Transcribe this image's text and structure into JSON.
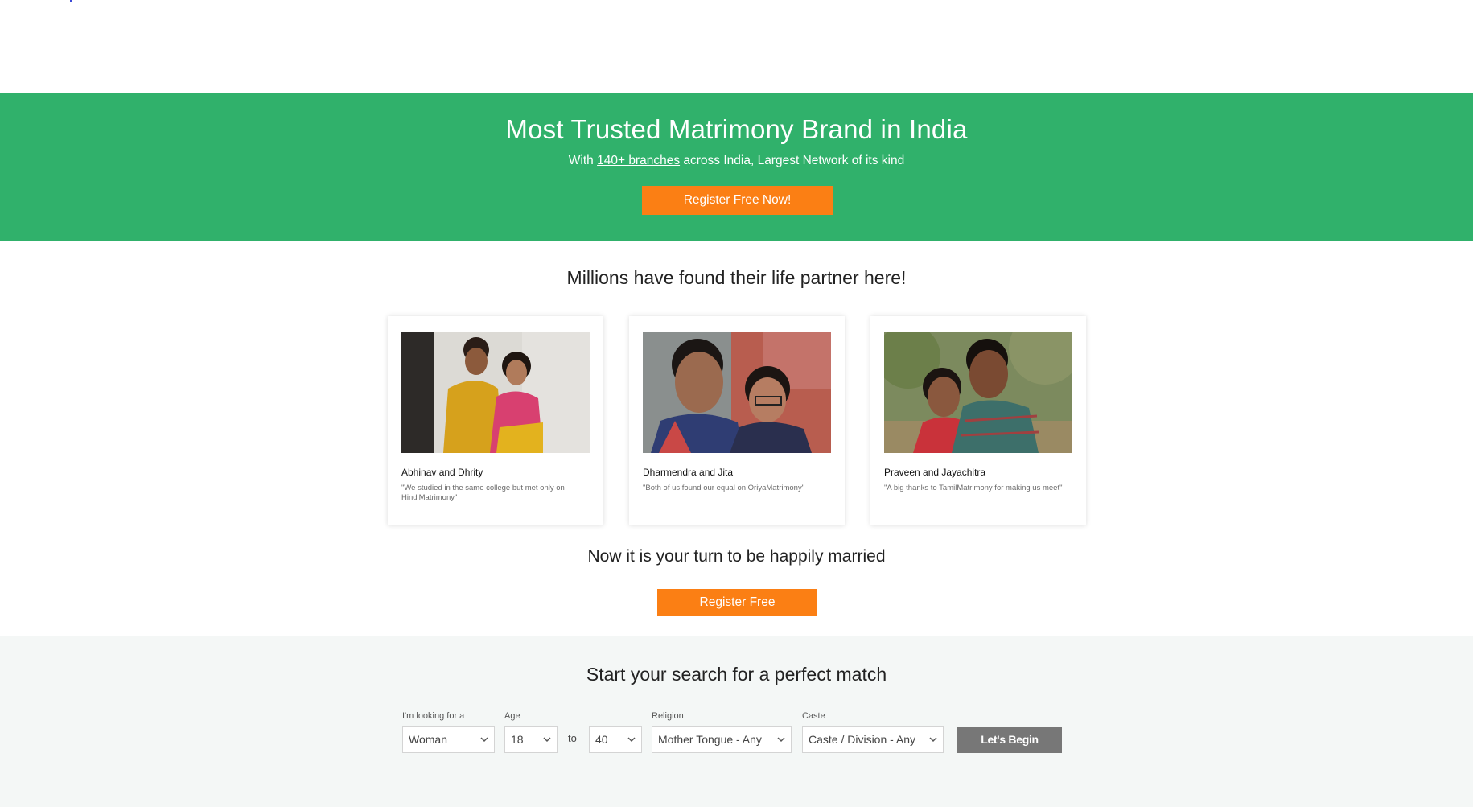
{
  "hero": {
    "title": "Most Trusted Matrimony Brand in India",
    "subtitle_prefix": "With ",
    "subtitle_link": "140+ branches",
    "subtitle_suffix": " across India, Largest Network of its kind",
    "cta_label": "Register Free Now!"
  },
  "stories": {
    "heading": "Millions have found their life partner here!",
    "items": [
      {
        "names": "Abhinav and Dhrity",
        "quote": "\"We studied in the same college but met only on HindiMatrimony\""
      },
      {
        "names": "Dharmendra and Jita",
        "quote": "\"Both of us found our equal on OriyaMatrimony\""
      },
      {
        "names": "Praveen and Jayachitra",
        "quote": "\"A big thanks to TamilMatrimony for making us meet\""
      }
    ]
  },
  "turn": {
    "heading": "Now it is your turn to be happily married",
    "cta_label": "Register Free"
  },
  "search": {
    "heading": "Start your search for a perfect match",
    "looking_for_label": "I'm looking for a",
    "looking_for_value": "Woman",
    "age_label": "Age",
    "age_from": "18",
    "age_to_word": "to",
    "age_to": "40",
    "religion_label": "Religion",
    "religion_value": "Mother Tongue - Any",
    "caste_label": "Caste",
    "caste_value": "Caste / Division - Any",
    "submit_label": "Let's Begin"
  },
  "colors": {
    "hero_green": "#30b16b",
    "cta_orange": "#fb7f14",
    "search_bg": "#f4f7f6",
    "begin_button": "#777777"
  }
}
